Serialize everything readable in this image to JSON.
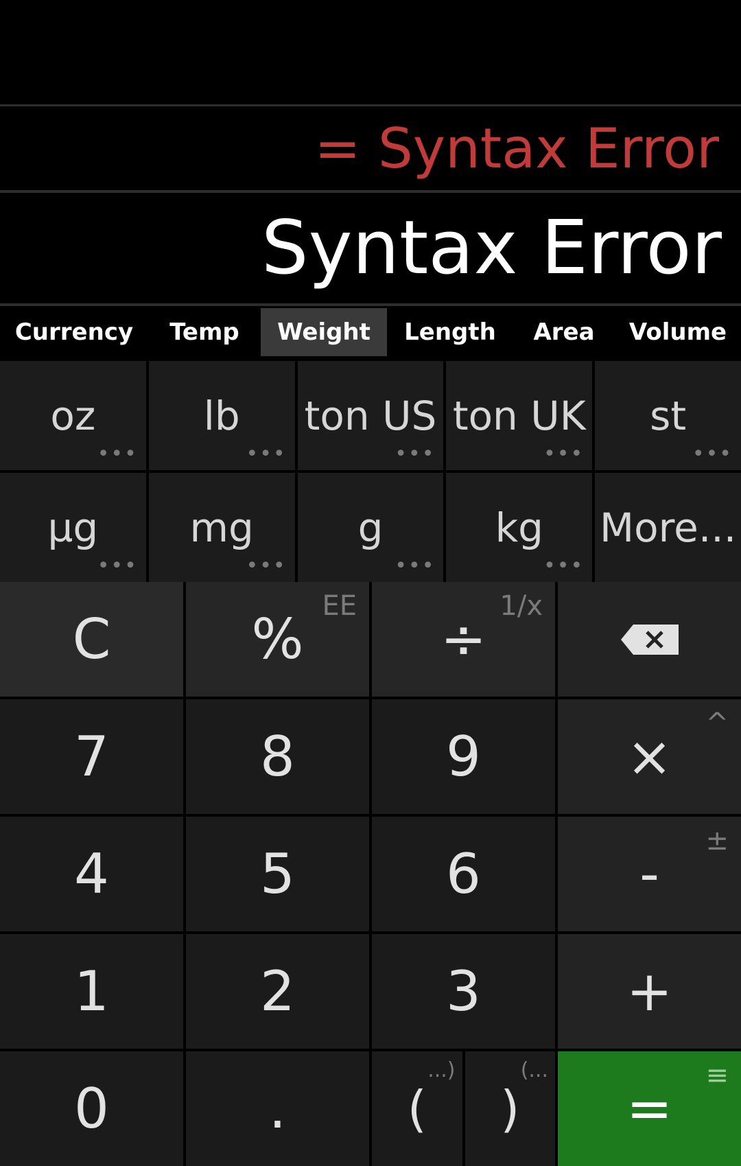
{
  "display": {
    "result": "= Syntax Error",
    "input": "Syntax Error",
    "result_color": "#c23b3b"
  },
  "tabs": [
    {
      "label": "Currency",
      "active": false
    },
    {
      "label": "Temp",
      "active": false
    },
    {
      "label": "Weight",
      "active": true
    },
    {
      "label": "Length",
      "active": false
    },
    {
      "label": "Area",
      "active": false
    },
    {
      "label": "Volume",
      "active": false
    }
  ],
  "units": [
    {
      "label": "oz",
      "dots": "•••"
    },
    {
      "label": "lb",
      "dots": "•••"
    },
    {
      "label": "ton US",
      "dots": "•••"
    },
    {
      "label": "ton UK",
      "dots": "•••"
    },
    {
      "label": "st",
      "dots": "•••"
    },
    {
      "label": "µg",
      "dots": "•••"
    },
    {
      "label": "mg",
      "dots": "•••"
    },
    {
      "label": "g",
      "dots": "•••"
    },
    {
      "label": "kg",
      "dots": "•••"
    },
    {
      "label": "More...",
      "dots": ""
    }
  ],
  "keys": {
    "clear": "C",
    "percent": "%",
    "percent_alt": "EE",
    "divide": "÷",
    "divide_alt": "1/x",
    "backspace_icon": "backspace-icon",
    "seven": "7",
    "eight": "8",
    "nine": "9",
    "multiply": "×",
    "multiply_alt": "^",
    "four": "4",
    "five": "5",
    "six": "6",
    "minus": "-",
    "minus_alt": "±",
    "one": "1",
    "two": "2",
    "three": "3",
    "plus": "+",
    "zero": "0",
    "dot": ".",
    "open_paren": "(",
    "open_paren_alt": "...)",
    "close_paren": ")",
    "close_paren_alt": "(...",
    "equals": "=",
    "equals_alt": "≡",
    "equals_color": "#1d7a1d"
  }
}
